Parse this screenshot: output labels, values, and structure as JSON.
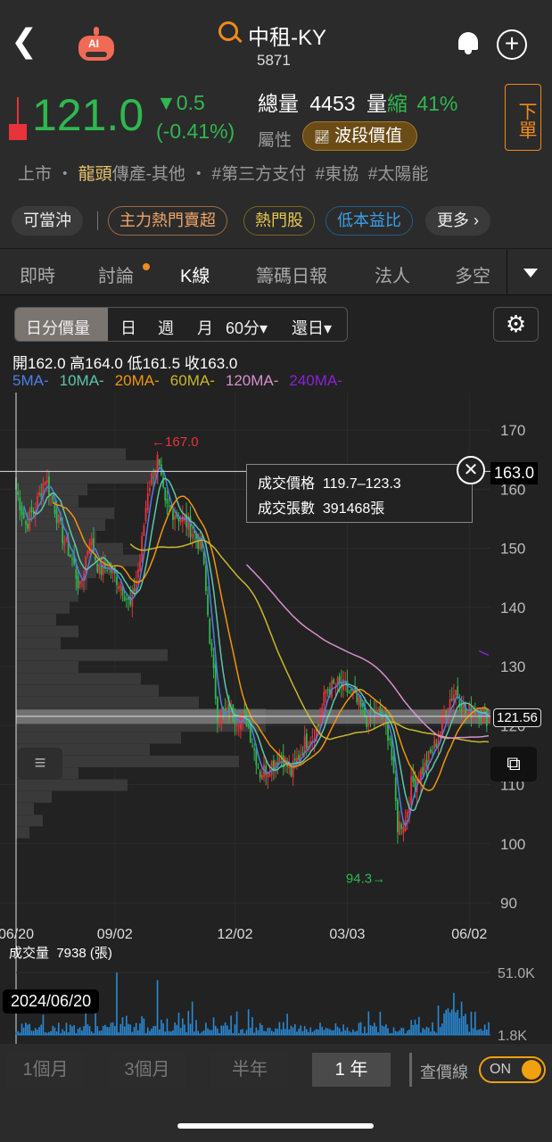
{
  "header": {
    "title": "中租-KY",
    "code": "5871",
    "ai_label": "AI"
  },
  "quote": {
    "price": "121.0",
    "change": "▼0.5",
    "change_pct": "(-0.41%)",
    "total_vol_label": "總量",
    "total_vol": "4453",
    "vol_label": "量",
    "vol_state": "縮",
    "vol_pct": "41%",
    "attr_label": "屬性",
    "attr_badge": "波段價值",
    "order_btn": "下單"
  },
  "tags": {
    "market": "上市",
    "dot": "・",
    "leader": "龍頭",
    "industry": "傳產-其他",
    "dot2": "・",
    "t1": "#第三方支付",
    "t2": "#東協",
    "t3": "#太陽能"
  },
  "chips": [
    "可當沖",
    "主力熱門賣超",
    "熱門股",
    "低本益比",
    "更多 ›"
  ],
  "tabs": [
    "即時",
    "討論",
    "K線",
    "籌碼日報",
    "法人",
    "多空"
  ],
  "periods": [
    "日分價量",
    "日",
    "週",
    "月",
    "60分▾",
    "還日▾"
  ],
  "ohlc": {
    "open_l": "開",
    "open": "162.0",
    "high_l": "高",
    "high": "164.0",
    "low_l": "低",
    "low": "161.5",
    "close_l": "收",
    "close": "163.0"
  },
  "ma_legend": [
    {
      "label": "5MA-",
      "color": "#4f7ee8"
    },
    {
      "label": "10MA-",
      "color": "#5cc7a8"
    },
    {
      "label": "20MA-",
      "color": "#f0950e"
    },
    {
      "label": "60MA-",
      "color": "#c9b72c"
    },
    {
      "label": "120MA-",
      "color": "#d88fd0"
    },
    {
      "label": "240MA-",
      "color": "#8a22d6"
    }
  ],
  "tooltip": {
    "price_label": "成交價格",
    "price_range": "119.7–123.3",
    "vol_label": "成交張數",
    "vol": "391468張"
  },
  "crosshair": {
    "price": "163.0",
    "date": "2024/06/20"
  },
  "price_line": "121.56",
  "vol_info": "成交量  7938 (張)",
  "ranges": [
    "1個月",
    "3個月",
    "半年",
    "1 年"
  ],
  "check_line": {
    "label": "查價線",
    "toggle": "ON"
  },
  "chart_data": {
    "type": "candlestick",
    "ylim": [
      90,
      170
    ],
    "yticks": [
      "170",
      "160",
      "150",
      "140",
      "130",
      "120",
      "110",
      "100",
      "90"
    ],
    "xticks": [
      {
        "t": 0,
        "label": "06/20"
      },
      {
        "t": 51,
        "label": "09/02"
      },
      {
        "t": 113,
        "label": "12/02"
      },
      {
        "t": 171,
        "label": "03/03"
      },
      {
        "t": 234,
        "label": "06/02"
      }
    ],
    "days": 245,
    "close_anchors": [
      [
        0,
        160
      ],
      [
        5,
        154
      ],
      [
        10,
        157
      ],
      [
        15,
        162
      ],
      [
        19,
        158
      ],
      [
        24,
        152
      ],
      [
        29,
        148
      ],
      [
        33,
        143
      ],
      [
        38,
        152
      ],
      [
        43,
        146
      ],
      [
        47,
        147
      ],
      [
        54,
        144
      ],
      [
        59,
        140
      ],
      [
        64,
        148
      ],
      [
        68,
        160
      ],
      [
        73,
        165
      ],
      [
        77,
        157
      ],
      [
        82,
        156
      ],
      [
        89,
        154
      ],
      [
        96,
        150
      ],
      [
        100,
        135
      ],
      [
        104,
        122
      ],
      [
        110,
        122
      ],
      [
        119,
        121
      ],
      [
        126,
        112
      ],
      [
        130,
        113
      ],
      [
        137,
        115
      ],
      [
        142,
        112
      ],
      [
        149,
        117
      ],
      [
        156,
        120
      ],
      [
        160,
        126
      ],
      [
        167,
        127
      ],
      [
        174,
        125
      ],
      [
        181,
        121
      ],
      [
        188,
        122
      ],
      [
        193,
        118
      ],
      [
        197,
        103
      ],
      [
        201,
        104
      ],
      [
        204,
        110
      ],
      [
        211,
        113
      ],
      [
        218,
        118
      ],
      [
        223,
        124
      ],
      [
        227,
        126
      ],
      [
        232,
        122
      ],
      [
        238,
        123
      ],
      [
        244,
        121
      ]
    ],
    "annotations": [
      {
        "t": 70,
        "price": 167.0,
        "label": "←167.0"
      },
      {
        "t": 197,
        "price": 94.3,
        "label": "94.3→"
      }
    ],
    "up_color": "#e8323c",
    "down_color": "#2fb84f",
    "volume": {
      "ylim_labels": [
        "51.0K",
        "1.8K"
      ],
      "max": 51000,
      "min": 1800,
      "spikes": [
        [
          52,
          51000
        ],
        [
          73,
          45000
        ],
        [
          91,
          28000
        ],
        [
          120,
          22000
        ],
        [
          188,
          20000
        ],
        [
          218,
          25000
        ],
        [
          226,
          35000
        ],
        [
          230,
          28000
        ]
      ]
    }
  }
}
